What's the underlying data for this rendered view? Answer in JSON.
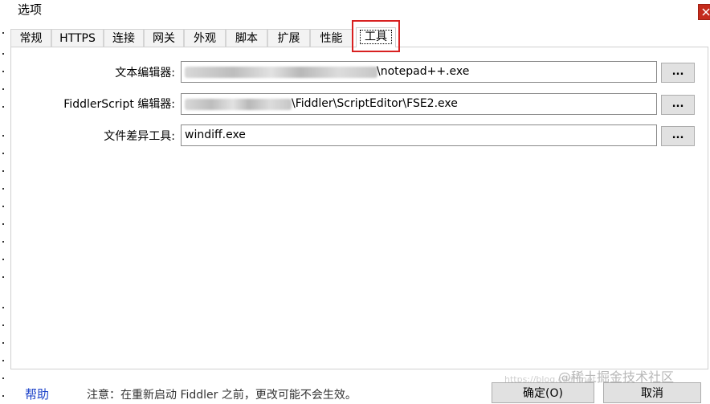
{
  "window": {
    "title": "选项"
  },
  "tabs": [
    {
      "label": "常规"
    },
    {
      "label": "HTTPS"
    },
    {
      "label": "连接"
    },
    {
      "label": "网关"
    },
    {
      "label": "外观"
    },
    {
      "label": "脚本"
    },
    {
      "label": "扩展"
    },
    {
      "label": "性能"
    },
    {
      "label": "工具",
      "active": true
    }
  ],
  "tools_panel": {
    "rows": [
      {
        "label": "文本编辑器:",
        "value_visible": "\\notepad++.exe",
        "button": "..."
      },
      {
        "label": "FiddlerScript 编辑器:",
        "value_visible": "\\Fiddler\\ScriptEditor\\FSE2.exe",
        "button": "..."
      },
      {
        "label": "文件差异工具:",
        "value_visible": "windiff.exe",
        "button": "..."
      }
    ]
  },
  "footer": {
    "help": "帮助",
    "note": "注意：在重新启动 Fiddler 之前，更改可能不会生效。",
    "ok_button": "确定(O)",
    "cancel_button": "取消",
    "watermark": "@稀土掘金技术社区"
  },
  "colors": {
    "close_button": "#c42b1c",
    "highlight_box": "#d82020",
    "help_link": "#1a40c8"
  },
  "icons": {
    "close": "close-icon"
  }
}
